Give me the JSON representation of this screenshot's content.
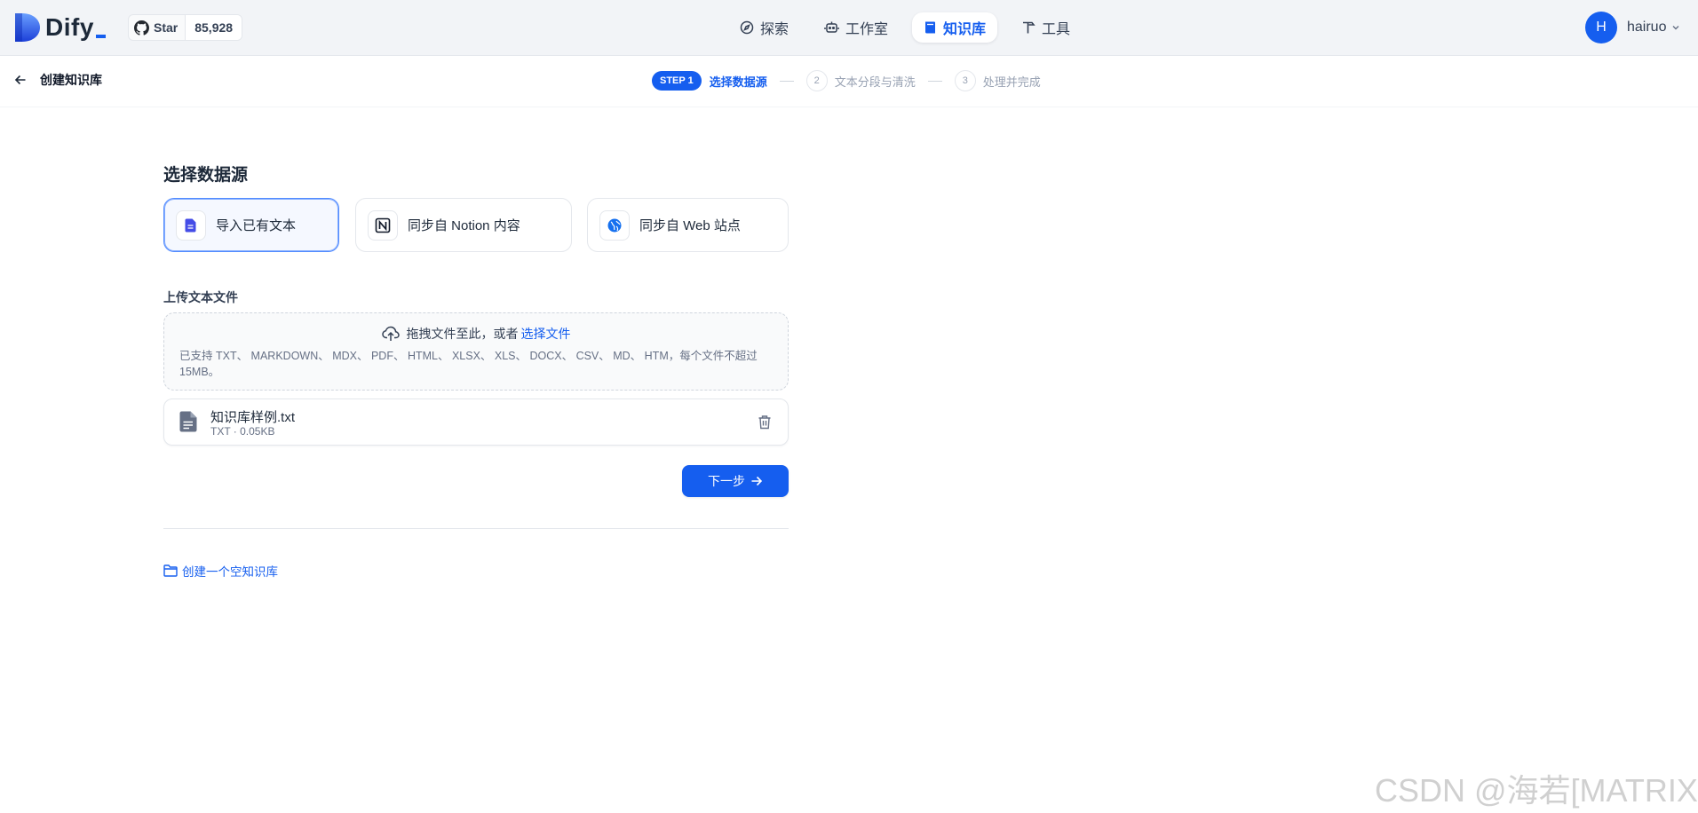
{
  "app": {
    "name": "Dify",
    "brand_color": "#155eef"
  },
  "github": {
    "label": "Star",
    "count": "85,928"
  },
  "nav": {
    "items": [
      {
        "label": "探索",
        "icon": "compass-icon",
        "active": false
      },
      {
        "label": "工作室",
        "icon": "robot-icon",
        "active": false
      },
      {
        "label": "知识库",
        "icon": "book-icon",
        "active": true
      },
      {
        "label": "工具",
        "icon": "hammer-icon",
        "active": false
      }
    ]
  },
  "user": {
    "initial": "H",
    "name": "hairuo"
  },
  "subheader": {
    "title": "创建知识库",
    "steps": [
      {
        "badge": "STEP 1",
        "label": "选择数据源",
        "active": true
      },
      {
        "number": "2",
        "label": "文本分段与清洗",
        "active": false
      },
      {
        "number": "3",
        "label": "处理并完成",
        "active": false
      }
    ]
  },
  "main": {
    "title": "选择数据源",
    "sources": [
      {
        "label": "导入已有文本",
        "icon": "file-text-icon",
        "active": true
      },
      {
        "label": "同步自 Notion 内容",
        "icon": "notion-icon",
        "active": false
      },
      {
        "label": "同步自 Web 站点",
        "icon": "globe-icon",
        "active": false
      }
    ],
    "upload": {
      "title": "上传文本文件",
      "drop_text": "拖拽文件至此，或者",
      "select_link": "选择文件",
      "support": "已支持 TXT、 MARKDOWN、 MDX、 PDF、 HTML、 XLSX、 XLS、 DOCX、 CSV、 MD、 HTM，每个文件不超过 15MB。"
    },
    "file": {
      "name": "知识库样例.txt",
      "meta": "TXT · 0.05KB"
    },
    "next_label": "下一步",
    "empty_kb_label": "创建一个空知识库"
  },
  "watermark": "CSDN @海若[MATRIX]"
}
